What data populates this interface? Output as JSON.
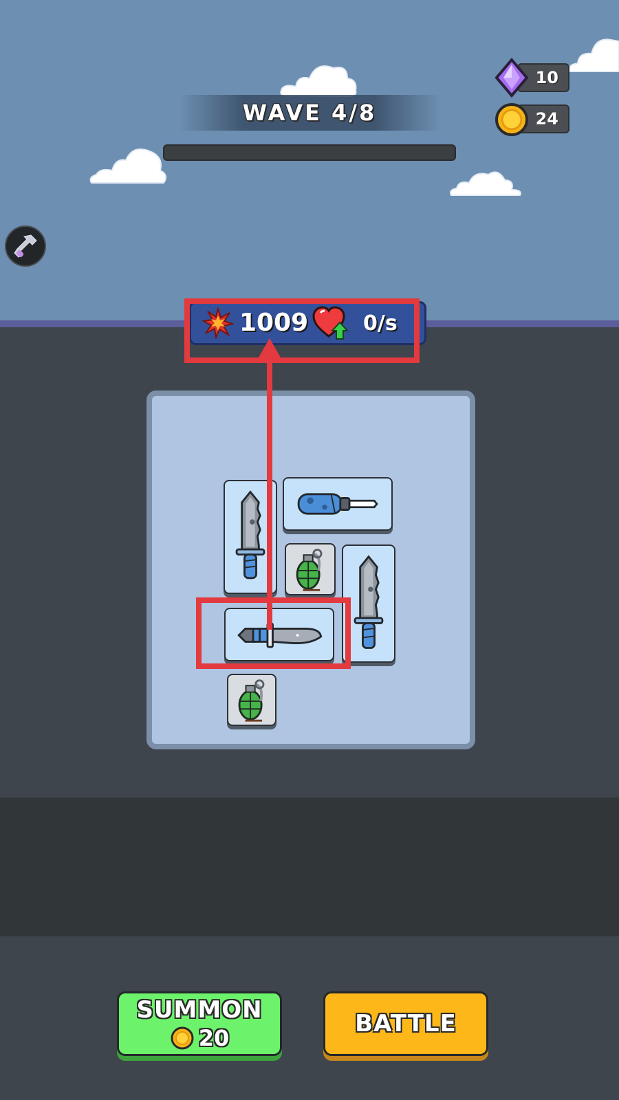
{
  "hud": {
    "wave_text": "WAVE 4/8",
    "wave_progress": 0,
    "gems": "10",
    "coins": "24"
  },
  "stats": {
    "damage": "1009",
    "regen": "0/s"
  },
  "buttons": {
    "summon_label": "SUMMON",
    "summon_cost": "20",
    "battle_label": "BATTLE"
  },
  "inventory": {
    "items": [
      "combat-knife",
      "screwdriver",
      "grenade",
      "combat-knife",
      "hunting-knife",
      "grenade"
    ]
  },
  "colors": {
    "sky": "#6d8fb2",
    "highlight": "#e23a3f",
    "summon": "#6df36b",
    "battle": "#fdb718",
    "stats_panel": "#33519a"
  }
}
